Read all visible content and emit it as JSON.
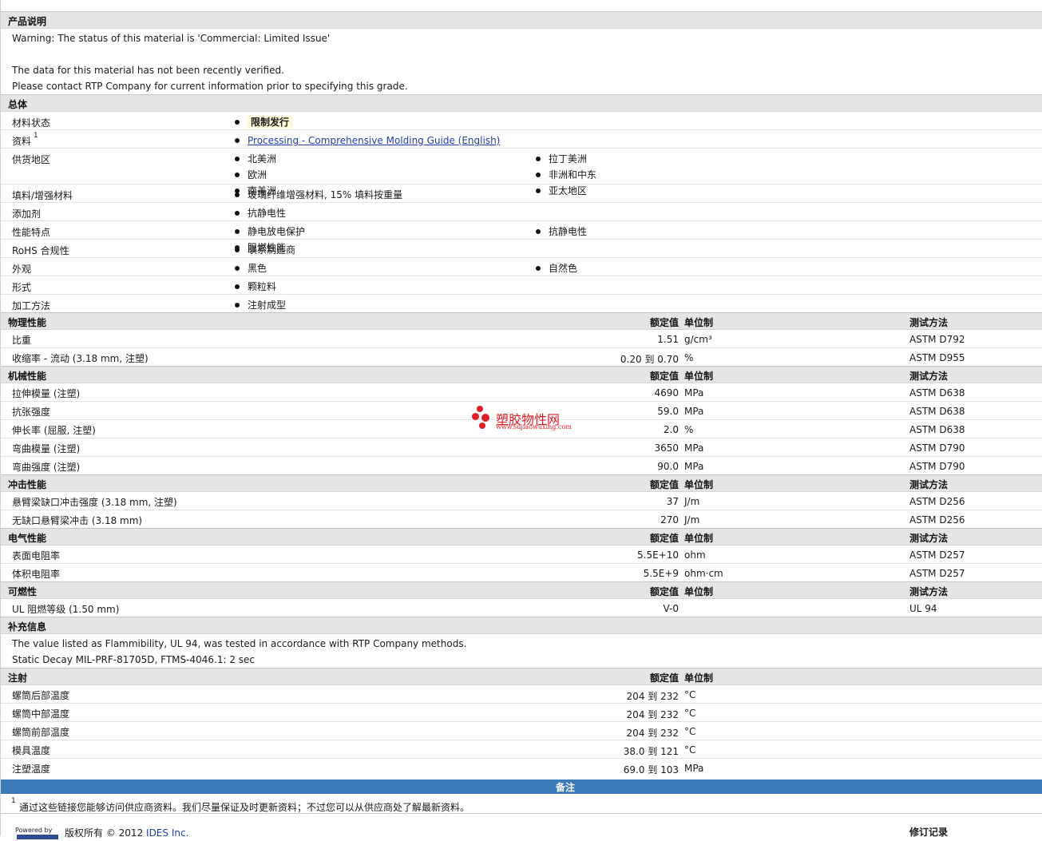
{
  "description": {
    "heading": "产品说明",
    "lines": [
      "Warning: The status of this material is 'Commercial: Limited Issue'",
      "",
      "The data for this material has not been recently verified.",
      "Please contact RTP Company for current information prior to specifying this grade."
    ]
  },
  "general": {
    "heading": "总体",
    "rows": [
      {
        "label": "材料状态",
        "items": [
          "限制发行"
        ]
      },
      {
        "label": "资料",
        "sup": "1",
        "items": [
          "Processing - Comprehensive Molding Guide (English)"
        ]
      },
      {
        "label": "供货地区",
        "items": [
          "北美洲",
          "拉丁美洲",
          "欧洲",
          "非洲和中东",
          "南美洲",
          "亚太地区"
        ]
      },
      {
        "label": "填料/增强材料",
        "items": [
          "玻璃纤维增强材料, 15% 填料按重量"
        ]
      },
      {
        "label": "添加剂",
        "items": [
          "抗静电性"
        ]
      },
      {
        "label": "性能特点",
        "items": [
          "静电放电保护",
          "抗静电性",
          "阻燃性能"
        ]
      },
      {
        "label": "RoHS 合规性",
        "items": [
          "联系制造商"
        ]
      },
      {
        "label": "外观",
        "items": [
          "黑色",
          "自然色"
        ]
      },
      {
        "label": "形式",
        "items": [
          "颗粒料"
        ]
      },
      {
        "label": "加工方法",
        "items": [
          "注射成型"
        ]
      }
    ]
  },
  "col_headers": {
    "rated": "额定值",
    "unit": "单位制",
    "test": "测试方法"
  },
  "physical": {
    "heading": "物理性能",
    "rows": [
      {
        "label": "比重",
        "value": "1.51",
        "unit": "g/cm³",
        "test": "ASTM D792"
      },
      {
        "label": "收缩率 - 流动 (3.18 mm, 注塑)",
        "value": "0.20 到  0.70",
        "unit": "%",
        "test": "ASTM D955"
      }
    ]
  },
  "mechanical": {
    "heading": "机械性能",
    "rows": [
      {
        "label": "拉伸模量 (注塑)",
        "value": "4690",
        "unit": "MPa",
        "test": "ASTM D638"
      },
      {
        "label": "抗张强度",
        "value": "59.0",
        "unit": "MPa",
        "test": "ASTM D638"
      },
      {
        "label": "伸长率 (屈服, 注塑)",
        "value": "2.0",
        "unit": "%",
        "test": "ASTM D638"
      },
      {
        "label": "弯曲模量 (注塑)",
        "value": "3650",
        "unit": "MPa",
        "test": "ASTM D790"
      },
      {
        "label": "弯曲强度 (注塑)",
        "value": "90.0",
        "unit": "MPa",
        "test": "ASTM D790"
      }
    ]
  },
  "impact": {
    "heading": "冲击性能",
    "rows": [
      {
        "label": "悬臂梁缺口冲击强度 (3.18 mm, 注塑)",
        "value": "37",
        "unit": "J/m",
        "test": "ASTM D256"
      },
      {
        "label": "无缺口悬臂梁冲击 (3.18 mm)",
        "value": "270",
        "unit": "J/m",
        "test": "ASTM D256"
      }
    ]
  },
  "electrical": {
    "heading": "电气性能",
    "rows": [
      {
        "label": "表面电阻率",
        "value": "5.5E+10",
        "unit": "ohm",
        "test": "ASTM D257"
      },
      {
        "label": "体积电阻率",
        "value": "5.5E+9",
        "unit": "ohm·cm",
        "test": "ASTM D257"
      }
    ]
  },
  "flammability": {
    "heading": "可燃性",
    "rows": [
      {
        "label": "UL 阻燃等级 (1.50 mm)",
        "value": "V-0",
        "unit": "",
        "test": "UL 94"
      }
    ]
  },
  "supplemental": {
    "heading": "补充信息",
    "lines": [
      "The value listed as Flammibility, UL 94, was tested in accordance with RTP Company methods.",
      "Static Decay MIL-PRF-81705D, FTMS-4046.1: 2 sec"
    ]
  },
  "injection": {
    "heading": "注射",
    "rows": [
      {
        "label": "螺筒后部温度",
        "value": "204 到  232",
        "unit": "°C"
      },
      {
        "label": "螺筒中部温度",
        "value": "204 到  232",
        "unit": "°C"
      },
      {
        "label": "螺筒前部温度",
        "value": "204 到  232",
        "unit": "°C"
      },
      {
        "label": "模具温度",
        "value": "38.0 到  121",
        "unit": "°C"
      },
      {
        "label": "注塑温度",
        "value": "69.0 到  103",
        "unit": "MPa"
      }
    ]
  },
  "notes": {
    "heading": "备注",
    "footnote_mark": "1",
    "footnote": "通过这些链接您能够访问供应商资料。我们尽量保证及时更新资料；不过您可以从供应商处了解最新资料。"
  },
  "footer": {
    "powered_by": "Powered by",
    "copyright_label": "版权所有",
    "copyright_year": "© 2012",
    "company": "IDES Inc.",
    "revision": "修订记录"
  },
  "watermark": {
    "name": "塑胶物性网",
    "url": "www.sujiaowuxing.com"
  }
}
